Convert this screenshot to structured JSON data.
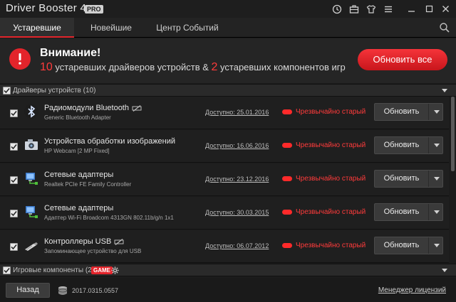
{
  "app": {
    "name": "Driver Booster 4",
    "version_suffix": ".3",
    "badge": "PRO"
  },
  "tabs": [
    {
      "label": "Устаревшие",
      "active": true
    },
    {
      "label": "Новейшие",
      "active": false
    },
    {
      "label": "Центр Событий",
      "active": false
    }
  ],
  "alert": {
    "title": "Внимание!",
    "outdated_drivers_count": "10",
    "drivers_text": " устаревших драйверов устройств & ",
    "outdated_components_count": "2",
    "components_text": " устаревших компонентов игр",
    "update_all_label": "Обновить все"
  },
  "sections": {
    "drivers": {
      "label": "Драйверы устройств (10)"
    },
    "games": {
      "label": "Игровые компоненты (2)",
      "badge": "GAME"
    }
  },
  "drivers": [
    {
      "name": "Радиомодули Bluetooth",
      "sub": "Generic Bluetooth Adapter",
      "available": "Доступно: 25.01.2016",
      "status": "Чрезвычайно старый",
      "button": "Обновить",
      "icon": "bluetooth-icon",
      "unsigned": true
    },
    {
      "name": "Устройства обработки изображений",
      "sub": "HP Webcam [2 MP Fixed]",
      "available": "Доступно: 16.06.2016",
      "status": "Чрезвычайно старый",
      "button": "Обновить",
      "icon": "camera-icon",
      "unsigned": false
    },
    {
      "name": "Сетевые адаптеры",
      "sub": "Realtek PCIe FE Family Controller",
      "available": "Доступно: 23.12.2016",
      "status": "Чрезвычайно старый",
      "button": "Обновить",
      "icon": "network-icon",
      "unsigned": false
    },
    {
      "name": "Сетевые адаптеры",
      "sub": "Адаптер Wi-Fi Broadcom 4313GN 802.11b/g/n 1x1",
      "available": "Доступно: 30.03.2015",
      "status": "Чрезвычайно старый",
      "button": "Обновить",
      "icon": "network-icon",
      "unsigned": false
    },
    {
      "name": "Контроллеры USB",
      "sub": "Запоминающее устройство для USB",
      "available": "Доступно: 06.07.2012",
      "status": "Чрезвычайно старый",
      "button": "Обновить",
      "icon": "usb-icon",
      "unsigned": true
    }
  ],
  "footer": {
    "back_label": "Назад",
    "build": "2017.0315.0557",
    "license_label": "Менеджер лицензий"
  },
  "colors": {
    "accent_red": "#e3242b",
    "background": "#1c1c1c"
  }
}
